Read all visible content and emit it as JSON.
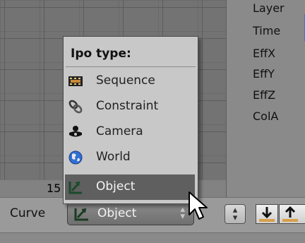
{
  "channels": [
    "Layer",
    "Time",
    "EffX",
    "EffY",
    "EffZ",
    "ColA"
  ],
  "frame_number": "15",
  "menu": {
    "title": "Ipo type:",
    "items": [
      {
        "label": "Sequence",
        "icon": "sequence-icon"
      },
      {
        "label": "Constraint",
        "icon": "constraint-icon"
      },
      {
        "label": "Camera",
        "icon": "camera-icon"
      },
      {
        "label": "World",
        "icon": "world-icon"
      },
      {
        "label": "Object",
        "icon": "object-icon",
        "active": true
      }
    ]
  },
  "header": {
    "curve_label": "Curve",
    "selected_type": "Object"
  },
  "colors": {
    "menu_bg": "#c8c8c8",
    "menu_active": "#5f5f5f",
    "select_bg": "#7a7a7a",
    "world_blue": "#2f6fd6",
    "object_green": "#1c4a2c"
  }
}
